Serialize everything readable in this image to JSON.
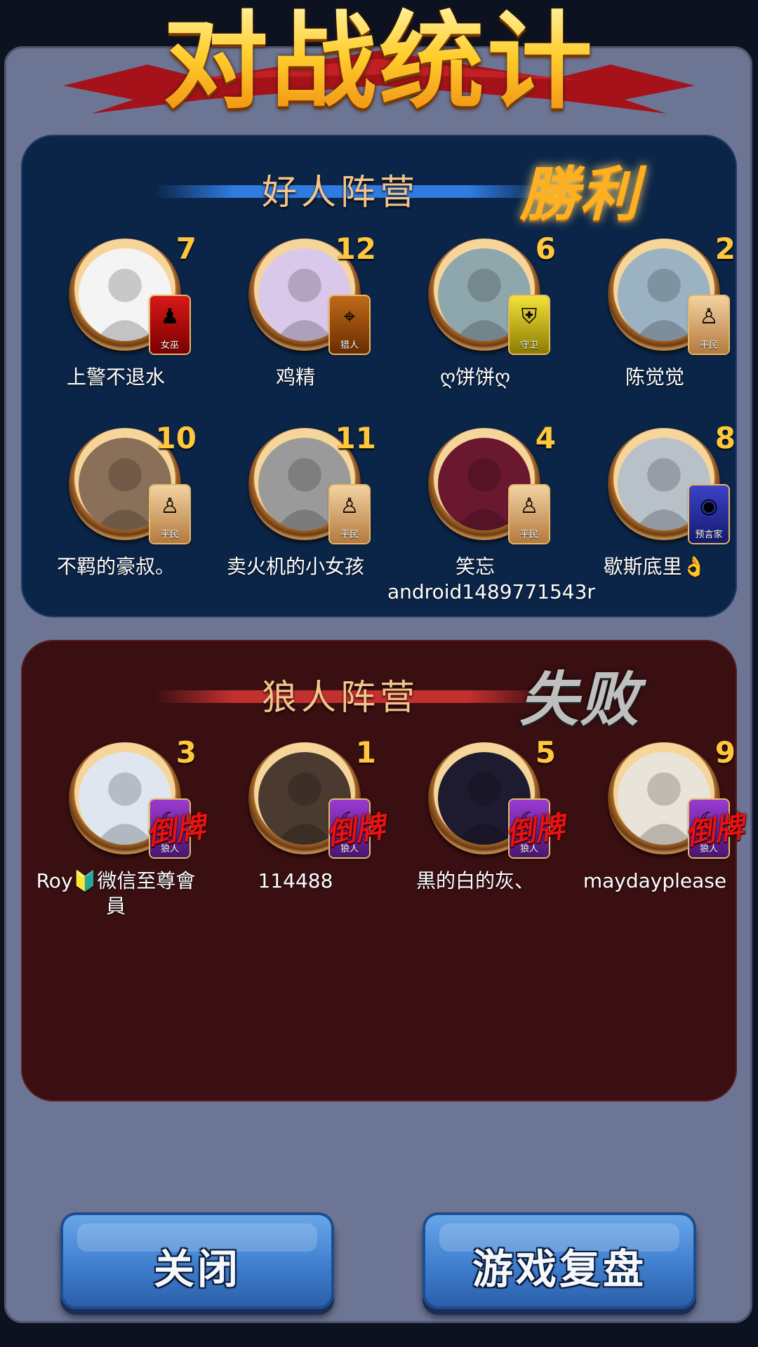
{
  "title": "对战统计",
  "good_camp": {
    "name": "好人阵营",
    "result": "勝利",
    "players": [
      {
        "seat": "7",
        "name": "上警不退水",
        "role": "女巫",
        "role_class": "witch",
        "icon": "witch-icon",
        "avatar_color": "#f4f4f4"
      },
      {
        "seat": "12",
        "name": "鸡精",
        "role": "猎人",
        "role_class": "hunter",
        "icon": "crosshair-icon",
        "avatar_color": "#d9c8ea"
      },
      {
        "seat": "6",
        "name": "ღ饼饼ღ",
        "role": "守卫",
        "role_class": "guard",
        "icon": "shield-icon",
        "avatar_color": "#8ea7ad"
      },
      {
        "seat": "2",
        "name": "陈觉觉",
        "role": "平民",
        "role_class": "villager",
        "icon": "villager-icon",
        "avatar_color": "#9bb2c2"
      },
      {
        "seat": "10",
        "name": "不羁的豪叔。",
        "role": "平民",
        "role_class": "villager",
        "icon": "villager-icon",
        "avatar_color": "#8a7058"
      },
      {
        "seat": "11",
        "name": "卖火机的小女孩",
        "role": "平民",
        "role_class": "villager",
        "icon": "villager-icon",
        "avatar_color": "#9a9a9a"
      },
      {
        "seat": "4",
        "name": "笑忘android1489771543r",
        "role": "平民",
        "role_class": "villager",
        "icon": "villager-icon",
        "avatar_color": "#6a1830"
      },
      {
        "seat": "8",
        "name": "歇斯底里👌",
        "role": "预言家",
        "role_class": "seer",
        "icon": "eye-icon",
        "avatar_color": "#b8c0c8"
      }
    ]
  },
  "bad_camp": {
    "name": "狼人阵营",
    "result": "失败",
    "players": [
      {
        "seat": "3",
        "name": "Roy🔰微信至尊會員",
        "role": "狼人",
        "role_class": "wolf",
        "icon": "wolf-icon",
        "stamp": "倒牌",
        "avatar_color": "#dfe6ef"
      },
      {
        "seat": "1",
        "name": "114488",
        "role": "狼人",
        "role_class": "wolf",
        "icon": "wolf-icon",
        "stamp": "倒牌",
        "avatar_color": "#4a3a30"
      },
      {
        "seat": "5",
        "name": "黒的白的灰、",
        "role": "狼人",
        "role_class": "wolf",
        "icon": "wolf-icon",
        "stamp": "倒牌",
        "avatar_color": "#1e1b30"
      },
      {
        "seat": "9",
        "name": "maydayplease",
        "role": "狼人",
        "role_class": "wolf",
        "icon": "wolf-icon",
        "stamp": "倒牌",
        "avatar_color": "#e9e4da"
      }
    ]
  },
  "buttons": {
    "close": "关闭",
    "replay": "游戏复盘"
  },
  "colors": {
    "good_bg": "#0b2549",
    "bad_bg": "#3a0f11",
    "panel_bg": "#6d7594",
    "seat_number": "#ffc83c",
    "button": "#3f7fcf"
  }
}
